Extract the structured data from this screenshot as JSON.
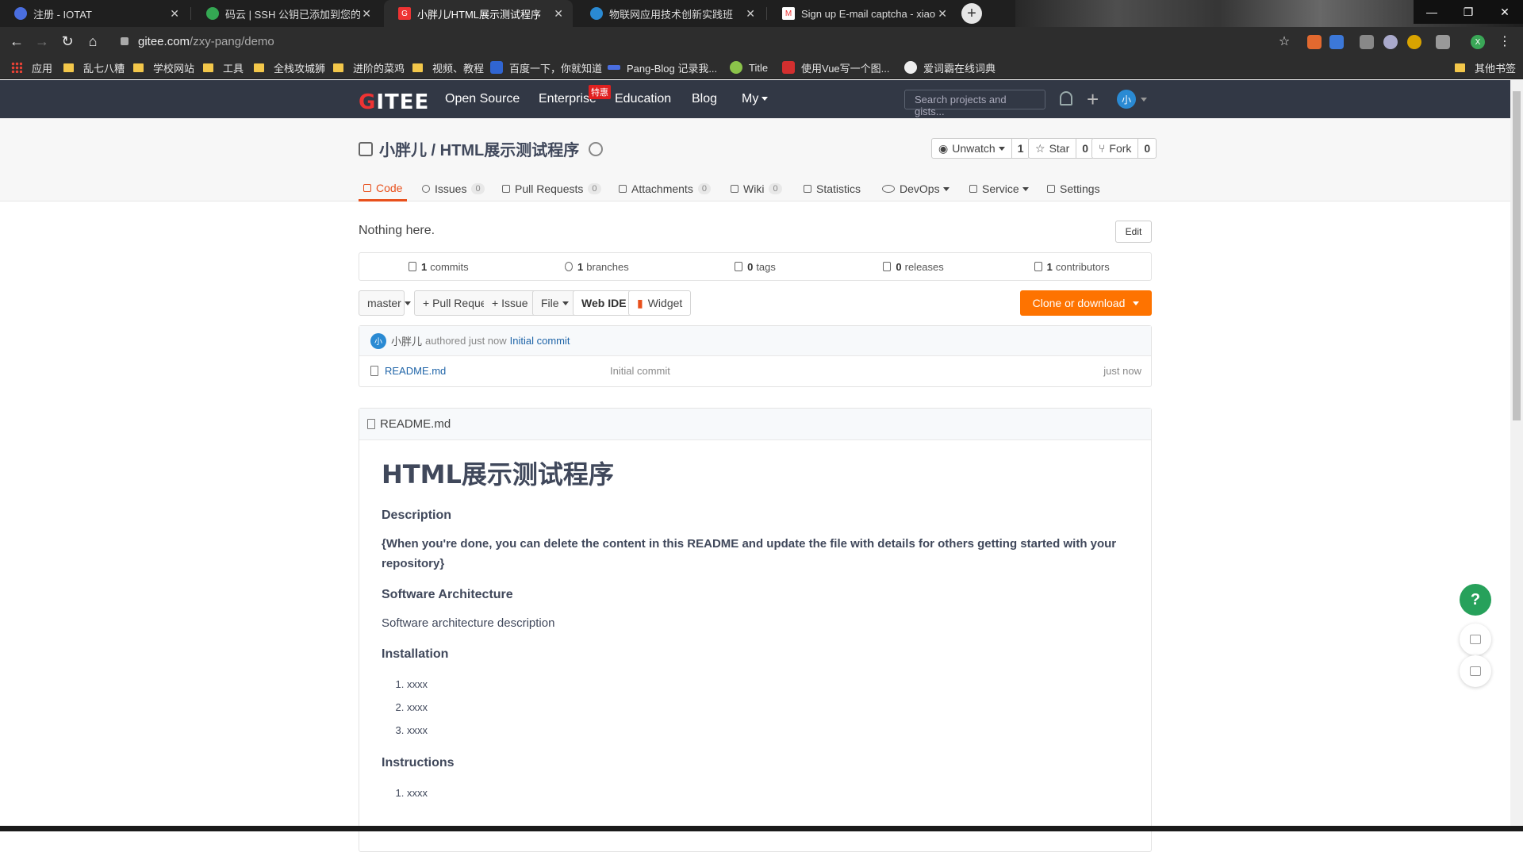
{
  "browser": {
    "tabs": [
      {
        "title": "注册 - IOTAT",
        "icon_color": "#4a6ee0"
      },
      {
        "title": "码云 | SSH 公钥已添加到您的帐号",
        "icon_color": "#34a853"
      },
      {
        "title": "小胖儿/HTML展示测试程序",
        "icon_color": "#e33"
      },
      {
        "title": "物联网应用技术创新实践班",
        "icon_color": "#2a8ad3"
      },
      {
        "title": "Sign up E-mail captcha - xiaop",
        "icon_color": "#e33"
      }
    ],
    "url_host": "gitee.com",
    "url_path": "/zxy-pang/demo",
    "bookmarks": [
      {
        "label": "应用",
        "type": "apps"
      },
      {
        "label": "乱七八糟",
        "type": "folder"
      },
      {
        "label": "学校网站",
        "type": "folder"
      },
      {
        "label": "工具",
        "type": "folder"
      },
      {
        "label": "全栈攻城狮",
        "type": "folder"
      },
      {
        "label": "进阶的菜鸡",
        "type": "folder"
      },
      {
        "label": "视频、教程",
        "type": "folder"
      },
      {
        "label": "百度一下，你就知道",
        "type": "site"
      },
      {
        "label": "Pang-Blog 记录我...",
        "type": "site"
      },
      {
        "label": "Title",
        "type": "site"
      },
      {
        "label": "使用Vue写一个图...",
        "type": "site"
      },
      {
        "label": "爱词霸在线词典",
        "type": "site"
      },
      {
        "label": "其他书签",
        "type": "folder"
      }
    ],
    "profile_initial": "X"
  },
  "sitenav": {
    "logo": "GITEE",
    "links": [
      "Open Source",
      "Enterprise",
      "Education",
      "Blog",
      "My"
    ],
    "hot_badge": "特惠",
    "search_placeholder": "Search projects and gists...",
    "avatar": "小"
  },
  "repo": {
    "title": "小胖儿 / HTML展示测试程序",
    "unwatch_label": "Unwatch",
    "unwatch_count": "1",
    "star_label": "Star",
    "star_count": "0",
    "fork_label": "Fork",
    "fork_count": "0",
    "tabs": [
      {
        "label": "Code",
        "count": ""
      },
      {
        "label": "Issues",
        "count": "0"
      },
      {
        "label": "Pull Requests",
        "count": "0"
      },
      {
        "label": "Attachments",
        "count": "0"
      },
      {
        "label": "Wiki",
        "count": "0"
      },
      {
        "label": "Statistics",
        "count": ""
      },
      {
        "label": "DevOps",
        "count": ""
      },
      {
        "label": "Service",
        "count": ""
      },
      {
        "label": "Settings",
        "count": ""
      }
    ]
  },
  "main": {
    "description": "Nothing here.",
    "edit_label": "Edit",
    "stats": [
      {
        "num": "1",
        "label": "commits"
      },
      {
        "num": "1",
        "label": "branches"
      },
      {
        "num": "0",
        "label": "tags"
      },
      {
        "num": "0",
        "label": "releases"
      },
      {
        "num": "1",
        "label": "contributors"
      }
    ],
    "branch": "master",
    "pull_request_label": "+ Pull Request",
    "issue_label": "+ Issue",
    "file_label": "File",
    "webide_label": "Web IDE",
    "widget_label": "Widget",
    "clone_label": "Clone or download",
    "commit": {
      "avatar": "小",
      "author": "小胖儿",
      "meta": "authored just now",
      "message": "Initial commit"
    },
    "files": [
      {
        "name": "README.md",
        "message": "Initial commit",
        "time": "just now"
      }
    ]
  },
  "readme": {
    "filename": "README.md",
    "h1": "HTML展示测试程序",
    "description_heading": "Description",
    "description_text": "{When you're done, you can delete the content in this README and update the file with details for others getting started with your repository}",
    "arch_heading": "Software Architecture",
    "arch_text": "Software architecture description",
    "install_heading": "Installation",
    "install_items": [
      "xxxx",
      "xxxx",
      "xxxx"
    ],
    "instructions_heading": "Instructions",
    "instructions_items": [
      "xxxx"
    ]
  },
  "float": {
    "help": "?"
  },
  "colors": {
    "accent": "#fe7300",
    "link": "#2065a8",
    "active_tab": "#e8501c",
    "nav_bg": "#323845"
  }
}
